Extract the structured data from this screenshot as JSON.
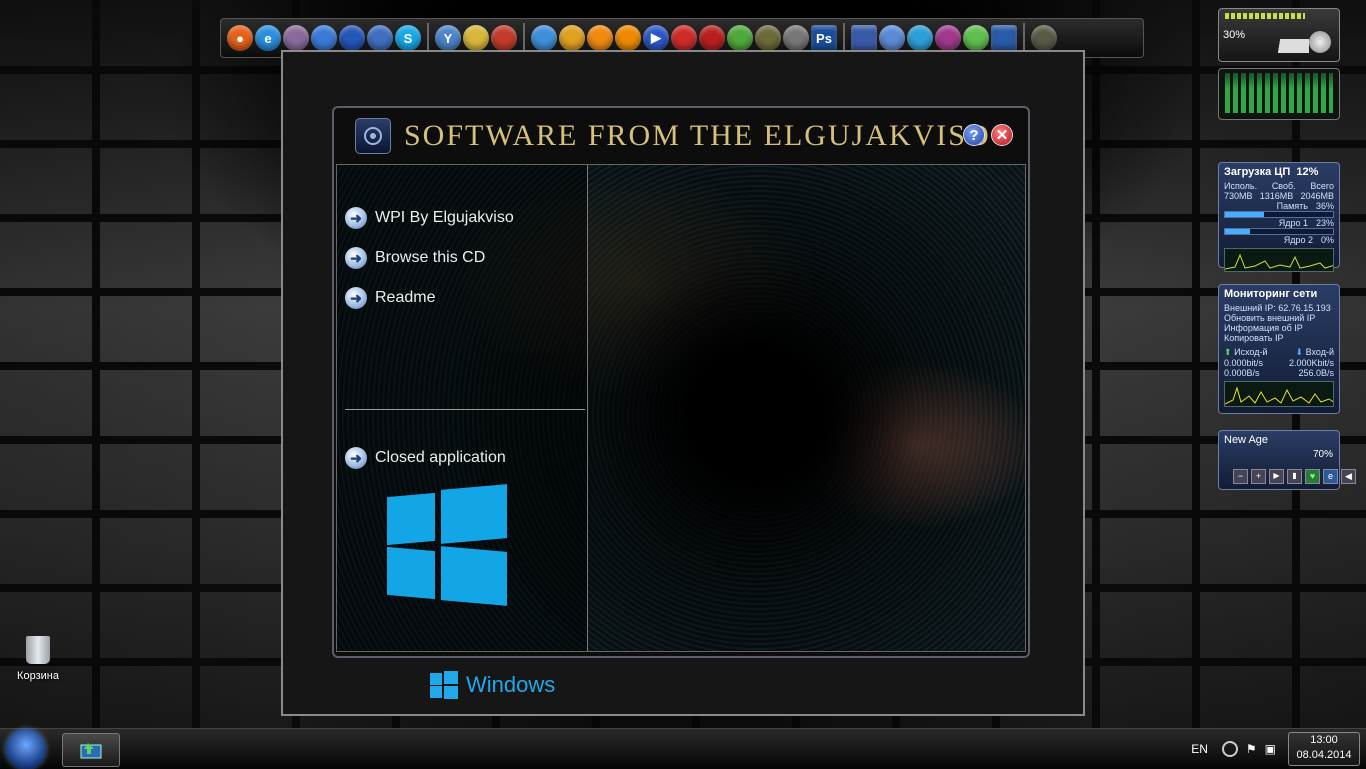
{
  "window": {
    "title": "SOFTWARE FROM THE ELGUJAKVISO",
    "help_symbol": "?",
    "close_symbol": "✕",
    "menu": [
      {
        "label": "WPI By Elgujakviso",
        "icon": "arrow-right-icon"
      },
      {
        "label": "Browse this CD",
        "icon": "arrow-right-icon"
      },
      {
        "label": "Readme",
        "icon": "arrow-right-icon"
      }
    ],
    "closed_app_label": "Closed application",
    "brand_label": "Windows"
  },
  "dock": {
    "icons": [
      "firefox-icon",
      "ie-icon",
      "tor-icon",
      "globe-icon",
      "globe-icon",
      "network-icon",
      "skype-icon",
      "yandex-icon",
      "settings-icon",
      "cd-icon",
      "teamviewer-icon",
      "tools-icon",
      "aimp-icon",
      "vlc-icon",
      "media-player-icon",
      "gom-icon",
      "cd-burn-icon",
      "utorrent-icon",
      "archive-icon",
      "photoshop-icon",
      "floppy-icon",
      "bookmark-icon",
      "globe-icon",
      "winrar-icon",
      "device-icon",
      "monitor-icon",
      "bag-icon"
    ],
    "photoshop_label": "Ps"
  },
  "gadgets": {
    "volume": {
      "percent_label": "30%"
    },
    "cpu": {
      "title": "Загрузка ЦП",
      "value": "12%",
      "headers": [
        "Исполь.",
        "Своб.",
        "Всего"
      ],
      "values": [
        "730MB",
        "1316MB",
        "2046MB"
      ],
      "rows": [
        {
          "label": "Память",
          "value": "36%",
          "fill": 0.36
        },
        {
          "label": "Ядро 1",
          "value": "23%",
          "fill": 0.23
        },
        {
          "label": "Ядро 2",
          "value": "0%",
          "fill": 0.0
        }
      ]
    },
    "network": {
      "title": "Мониторинг сети",
      "external_ip": "Внешний IP: 62.76.15.193",
      "lines": [
        "Обновить внешний IP",
        "Информация об IP",
        "Копировать IP"
      ],
      "out_label": "Исход-й",
      "in_label": "Вход-й",
      "out_values": [
        "0.000bit/s",
        "0.000B/s"
      ],
      "in_values": [
        "2.000Kbit/s",
        "256.0B/s"
      ]
    },
    "player": {
      "title": "New Age",
      "volume": "70%"
    }
  },
  "desktop": {
    "recycle_bin_label": "Корзина"
  },
  "taskbar": {
    "language": "EN",
    "time": "13:00",
    "date": "08.04.2014"
  },
  "colors": {
    "title_gold": "#d6c07c",
    "win_blue": "#12a6e6"
  }
}
